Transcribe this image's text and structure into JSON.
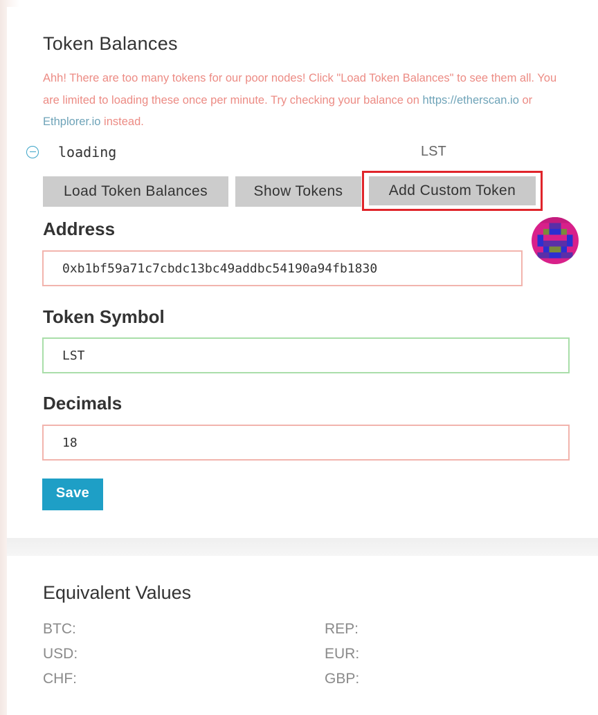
{
  "token_balances": {
    "title": "Token Balances",
    "warning": {
      "text_before": "Ahh! There are too many tokens for our poor nodes! Click \"Load Token Balances\" to see them all. You are limited to loading these once per minute. Try checking your balance on ",
      "link1": "https://etherscan.io",
      "text_mid": " or ",
      "link2": "Ethplorer.io",
      "text_after": " instead."
    },
    "token_row": {
      "name": "loading",
      "symbol": "LST"
    },
    "buttons": {
      "load": "Load Token Balances",
      "show": "Show Tokens",
      "add_custom": "Add Custom Token"
    },
    "highlight_color": "#e0242a",
    "accent_color": "#1e9fc6"
  },
  "custom_token_form": {
    "address_label": "Address",
    "address_value": "0xb1bf59a71c7cbdc13bc49addbc54190a94fb1830",
    "symbol_label": "Token Symbol",
    "symbol_value": "LST",
    "decimals_label": "Decimals",
    "decimals_value": "18",
    "save_label": "Save",
    "identicon": "address-identicon"
  },
  "equivalent_values": {
    "title": "Equivalent Values",
    "left": [
      "BTC:",
      "USD:",
      "CHF:"
    ],
    "right": [
      "REP:",
      "EUR:",
      "GBP:"
    ]
  }
}
